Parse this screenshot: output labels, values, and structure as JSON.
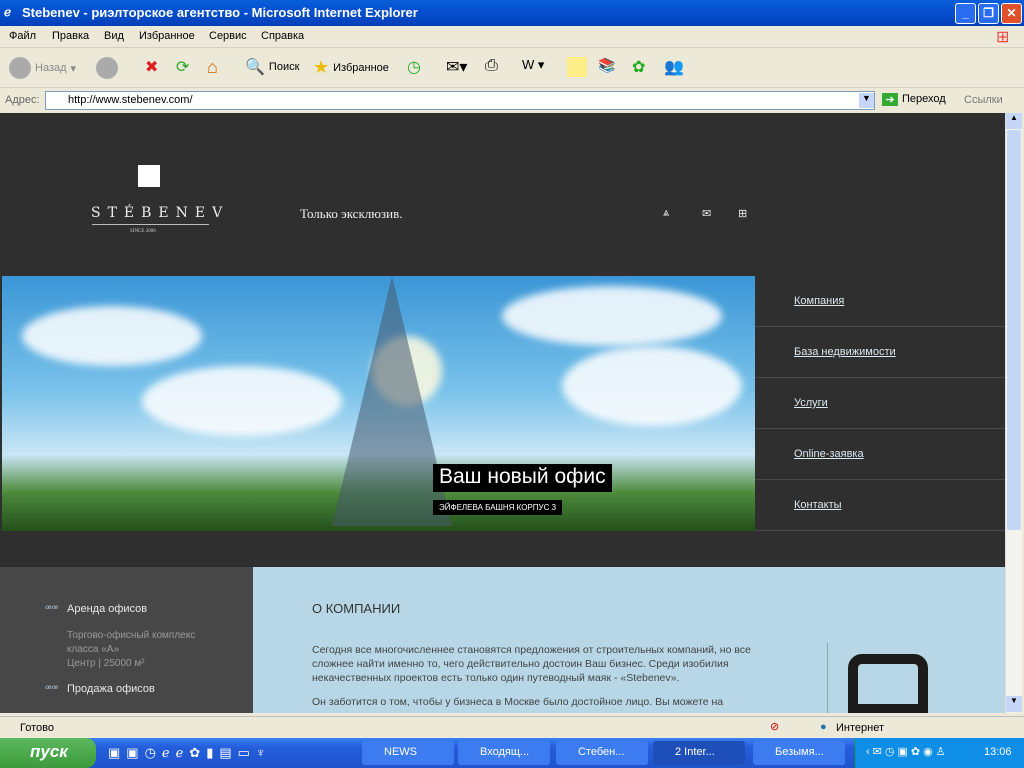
{
  "window": {
    "title": "Stebenev - риэлторское агентство - Microsoft Internet Explorer"
  },
  "menu": [
    "Файл",
    "Правка",
    "Вид",
    "Избранное",
    "Сервис",
    "Справка"
  ],
  "toolbar": {
    "back": "Назад",
    "search": "Поиск",
    "favorites": "Избранное"
  },
  "address": {
    "label": "Адрес:",
    "url": "http://www.stebenev.com/",
    "go": "Переход",
    "links": "Ссылки"
  },
  "site": {
    "logo": "STÉBENEV",
    "since": "SINCE 2006",
    "slogan": "Только эксклюзив.",
    "hero": {
      "caption": "Ваш новый офис",
      "subcaption": "ЭЙФЕЛЕВА БАШНЯ КОРПУС 3"
    },
    "nav": [
      "Компания",
      "База недвижимости",
      "Услуги",
      "Online-заявка",
      "Контакты"
    ],
    "left": {
      "item1": "Аренда офисов",
      "desc1": "Торгово-офисный комплекс класса «А»",
      "desc2": "Центр | 25000 м²",
      "item2": "Продажа офисов"
    },
    "content": {
      "title": "О КОМПАНИИ",
      "p1": "Сегодня все многочисленнее становятся предложения от строительных компаний, но все сложнее найти именно то, чего действительно достоин Ваш бизнес. Среди изобилия некачественных проектов есть только один путеводный маяк - «Stebenev».",
      "p2": "Он заботится о том, чтобы у бизнеса в Москве было достойное лицо. Вы можете на"
    }
  },
  "status": {
    "text": "Готово",
    "zone": "Интернет"
  },
  "taskbar": {
    "start": "пуск",
    "tasks": [
      "NEWS",
      "Входящ...",
      "Стебен...",
      "2 Inter...",
      "Безымя..."
    ],
    "clock": "13:06"
  }
}
